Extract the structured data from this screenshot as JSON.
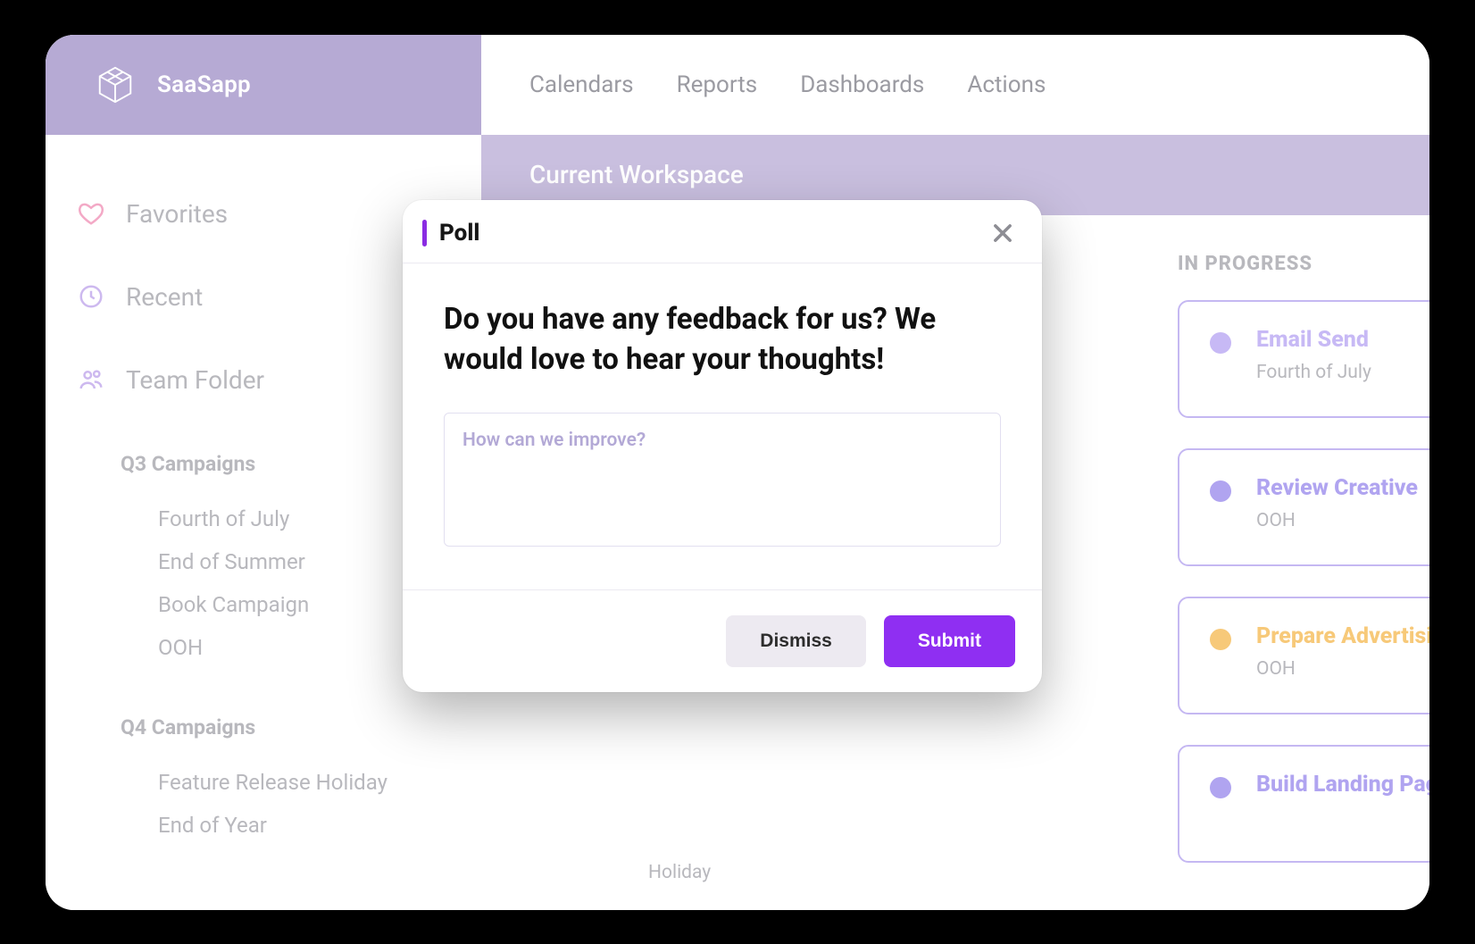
{
  "brand": {
    "name": "SaaSapp"
  },
  "topnav": {
    "items": [
      "Calendars",
      "Reports",
      "Dashboards",
      "Actions"
    ]
  },
  "workspace": {
    "label": "Current Workspace"
  },
  "sidebar": {
    "favorites_label": "Favorites",
    "recent_label": "Recent",
    "team_folder_label": "Team Folder",
    "groups": [
      {
        "title": "Q3 Campaigns",
        "items": [
          "Fourth of July",
          "End of Summer",
          "Book Campaign",
          "OOH"
        ]
      },
      {
        "title": "Q4 Campaigns",
        "items": [
          "Feature Release Holiday",
          "End of Year"
        ]
      }
    ]
  },
  "board": {
    "behind_card_sub": "Holiday",
    "columns": [
      {
        "title": "IN PROGRESS",
        "cards": [
          {
            "dot_color": "#c7b9f5",
            "title_color": "#c7b9f5",
            "title": "Email Send",
            "sub": "Fourth of July"
          },
          {
            "dot_color": "#b0a4f0",
            "title_color": "#b0a4f0",
            "title": "Review Creative",
            "sub": "OOH"
          },
          {
            "dot_color": "#f7c979",
            "title_color": "#f7c979",
            "title": "Prepare Advertising",
            "sub": "OOH"
          },
          {
            "dot_color": "#b0a4f0",
            "title_color": "#b0a4f0",
            "title": "Build Landing Page",
            "sub": ""
          }
        ]
      }
    ]
  },
  "modal": {
    "title": "Poll",
    "question": "Do you have any feedback for us? We would love to hear your thoughts!",
    "placeholder": "How can we improve?",
    "dismiss_label": "Dismiss",
    "submit_label": "Submit"
  }
}
